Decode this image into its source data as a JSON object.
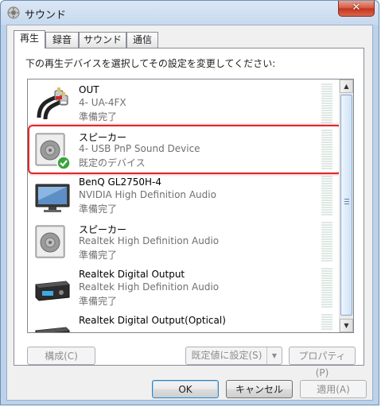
{
  "window": {
    "title": "サウンド",
    "close_glyph": "✕"
  },
  "tabs": [
    {
      "label": "再生",
      "active": true
    },
    {
      "label": "録音",
      "active": false
    },
    {
      "label": "サウンド",
      "active": false
    },
    {
      "label": "通信",
      "active": false
    }
  ],
  "instruction": "下の再生デバイスを選択してその設定を変更してください:",
  "devices": [
    {
      "name": "OUT",
      "desc": "4- UA-4FX",
      "status": "準備完了",
      "icon": "rca-cable-icon"
    },
    {
      "name": "スピーカー",
      "desc": "4- USB PnP Sound Device",
      "status": "既定のデバイス",
      "icon": "speaker-icon",
      "default": true
    },
    {
      "name": "BenQ GL2750H-4",
      "desc": "NVIDIA High Definition Audio",
      "status": "準備完了",
      "icon": "monitor-icon"
    },
    {
      "name": "スピーカー",
      "desc": "Realtek High Definition Audio",
      "status": "準備完了",
      "icon": "speaker-icon"
    },
    {
      "name": "Realtek Digital Output",
      "desc": "Realtek High Definition Audio",
      "status": "準備完了",
      "icon": "receiver-icon"
    },
    {
      "name": "Realtek Digital Output(Optical)",
      "desc": "",
      "status": "",
      "icon": "receiver-icon"
    }
  ],
  "buttons": {
    "configure": "構成(C)",
    "set_default": "既定値に設定(S)",
    "properties": "プロパティ(P)",
    "ok": "OK",
    "cancel": "キャンセル",
    "apply": "適用(A)"
  },
  "colors": {
    "highlight": "#e0262d",
    "check": "#3aa43a"
  }
}
